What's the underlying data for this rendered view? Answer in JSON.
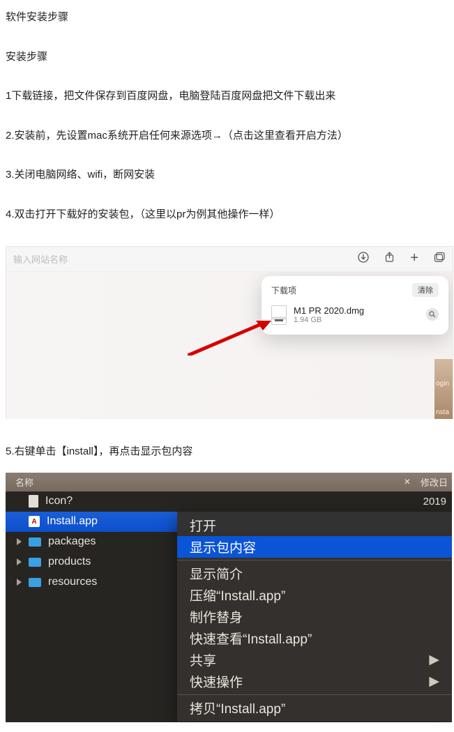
{
  "title": "软件安装步骤",
  "subtitle": "安装步骤",
  "steps": {
    "s1": "1下载链接，把文件保存到百度网盘，电脑登陆百度网盘把文件下载出来",
    "s2": "2.安装前，先设置mac系统开启任何来源选项→（点击这里查看开启方法）",
    "s3": "3.关闭电脑网络、wifi，断网安装",
    "s4": "4.双击打开下载好的安装包，（这里以pr为例其他操作一样）",
    "s5": "5.右键单击【install】，再点击显示包内容"
  },
  "shot1": {
    "placeholder": "输入网站名称",
    "popup_title": "下载项",
    "clear": "清除",
    "file_name": "M1 PR 2020.dmg",
    "file_size": "1.94 GB",
    "side1": "ogin",
    "side2": "nsta"
  },
  "shot2": {
    "col_name": "名称",
    "col_mod": "修改日",
    "rows": [
      {
        "kind": "doc",
        "label": "Icon?",
        "date": "2019"
      },
      {
        "kind": "app",
        "label": "Install.app",
        "date": ""
      },
      {
        "kind": "folder",
        "label": "packages",
        "date": ""
      },
      {
        "kind": "folder",
        "label": "products",
        "date": ""
      },
      {
        "kind": "folder",
        "label": "resources",
        "date": ""
      }
    ],
    "menu": [
      {
        "label": "打开",
        "sel": false
      },
      {
        "label": "显示包内容",
        "sel": true
      },
      {
        "label": "---"
      },
      {
        "label": "显示简介"
      },
      {
        "label": "压缩“Install.app”"
      },
      {
        "label": "制作替身"
      },
      {
        "label": "快速查看“Install.app”"
      },
      {
        "label": "共享",
        "sub": true
      },
      {
        "label": "快速操作",
        "sub": true
      },
      {
        "label": "---"
      },
      {
        "label": "拷贝“Install.app”"
      }
    ]
  }
}
